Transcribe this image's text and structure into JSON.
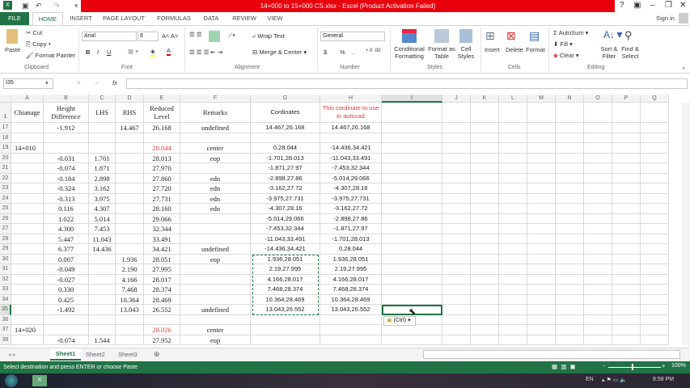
{
  "window": {
    "title": "14+000 to 15+000 CS.xlsx -  Excel (Product Activation Failed)",
    "help": "?",
    "sign_in": "Sign in"
  },
  "tabs": [
    "FILE",
    "HOME",
    "INSERT",
    "PAGE LAYOUT",
    "FORMULAS",
    "DATA",
    "REVIEW",
    "VIEW"
  ],
  "ribbon": {
    "clipboard": {
      "paste": "Paste",
      "cut": "Cut",
      "copy": "Copy",
      "format_painter": "Format Painter",
      "label": "Clipboard"
    },
    "font": {
      "name": "Arial",
      "size": "8",
      "label": "Font",
      "bold": "B",
      "italic": "I",
      "underline": "U"
    },
    "alignment": {
      "wrap": "Wrap Text",
      "merge": "Merge & Center",
      "label": "Alignment"
    },
    "number": {
      "format": "General",
      "currency": "$",
      "percent": "%",
      "comma": ",",
      "label": "Number"
    },
    "styles": {
      "cond": "Conditional",
      "cond2": "Formatting",
      "fat": "Format as",
      "fat2": "Table",
      "cs": "Cell",
      "cs2": "Styles",
      "label": "Styles"
    },
    "cells": {
      "insert": "Insert",
      "delete": "Delete",
      "format": "Format",
      "label": "Cells"
    },
    "editing": {
      "autosum": "AutoSum",
      "fill": "Fill",
      "clear": "Clear",
      "sort": "Sort &",
      "sort2": "Filter",
      "find": "Find &",
      "find2": "Select",
      "label": "Editing"
    }
  },
  "formula_bar": {
    "name_box": "I35",
    "fx": "fx",
    "value": ""
  },
  "columns": [
    "A",
    "B",
    "C",
    "D",
    "E",
    "F",
    "G",
    "H",
    "I",
    "J",
    "K",
    "L",
    "M",
    "N",
    "O",
    "P",
    "Q"
  ],
  "header_row": {
    "num": "1",
    "cells": [
      "Chianage",
      "Height Difference",
      "LHS",
      "RHS",
      "Reduced Level",
      "Remarks",
      "Cordinates",
      "This cordinate to use in autocad"
    ]
  },
  "rows": [
    {
      "n": "17",
      "c": [
        "",
        "-1.912",
        "",
        "14.467",
        "26.168",
        "undefined",
        "14.467,26.168",
        "14.467,26.168"
      ]
    },
    {
      "n": "18",
      "c": [
        "",
        "",
        "",
        "",
        "",
        "",
        "",
        ""
      ]
    },
    {
      "n": "19",
      "c": [
        "14+010",
        "",
        "",
        "",
        "28.044",
        "center",
        "0,28.044",
        "-14.436,34.421"
      ]
    },
    {
      "n": "20",
      "c": [
        "",
        "-0.031",
        "1.701",
        "",
        "28.013",
        "eop",
        "-1.701,28.013",
        "-11.043,33.491"
      ]
    },
    {
      "n": "21",
      "c": [
        "",
        "-0.074",
        "1.871",
        "",
        "27.970",
        "",
        "-1.871,27.97",
        "-7.453,32.344"
      ]
    },
    {
      "n": "22",
      "c": [
        "",
        "-0.184",
        "2.898",
        "",
        "27.860",
        "edn",
        "-2.898,27.86",
        "-5.014,29.066"
      ]
    },
    {
      "n": "23",
      "c": [
        "",
        "-0.324",
        "3.162",
        "",
        "27.720",
        "edn",
        "-3.162,27.72",
        "-4.307,28.16"
      ]
    },
    {
      "n": "24",
      "c": [
        "",
        "-0.313",
        "3.975",
        "",
        "27.731",
        "edn",
        "-3.975,27.731",
        "-3.975,27.731"
      ]
    },
    {
      "n": "25",
      "c": [
        "",
        "0.116",
        "4.307",
        "",
        "28.160",
        "edn",
        "-4.307,28.16",
        "-3.162,27.72"
      ]
    },
    {
      "n": "26",
      "c": [
        "",
        "1.022",
        "5.014",
        "",
        "29.066",
        "",
        "-5.014,29.066",
        "-2.898,27.86"
      ]
    },
    {
      "n": "27",
      "c": [
        "",
        "4.300",
        "7.453",
        "",
        "32.344",
        "",
        "-7.453,32.344",
        "-1.871,27.97"
      ]
    },
    {
      "n": "28",
      "c": [
        "",
        "5.447",
        "11.043",
        "",
        "33.491",
        "",
        "-11.043,33.491",
        "-1.701,28.013"
      ]
    },
    {
      "n": "29",
      "c": [
        "",
        "6.377",
        "14.436",
        "",
        "34.421",
        "undefined",
        "-14.436,34.421",
        "0,28.044"
      ]
    },
    {
      "n": "30",
      "c": [
        "",
        "0.007",
        "",
        "1.936",
        "28.051",
        "eop",
        "1.936,28.051",
        "1.936,28.051"
      ]
    },
    {
      "n": "31",
      "c": [
        "",
        "-0.049",
        "",
        "2.190",
        "27.995",
        "",
        "2.19,27.995",
        "2.19,27.995"
      ]
    },
    {
      "n": "32",
      "c": [
        "",
        "-0.027",
        "",
        "4.166",
        "28.017",
        "",
        "4.166,28.017",
        "4.166,28.017"
      ]
    },
    {
      "n": "33",
      "c": [
        "",
        "0.330",
        "",
        "7.468",
        "28.374",
        "",
        "7.468,28.374",
        "7.468,28.374"
      ]
    },
    {
      "n": "34",
      "c": [
        "",
        "0.425",
        "",
        "10.364",
        "28.469",
        "",
        "10.364,28.469",
        "10.364,28.469"
      ]
    },
    {
      "n": "35",
      "c": [
        "",
        "-1.492",
        "",
        "13.043",
        "26.552",
        "undefined",
        "13.043,26.552",
        "13.043,26.552"
      ]
    },
    {
      "n": "36",
      "c": [
        "",
        "",
        "",
        "",
        "",
        "",
        "",
        ""
      ]
    },
    {
      "n": "37",
      "c": [
        "14+020",
        "",
        "",
        "",
        "28.026",
        "center",
        "",
        ""
      ]
    },
    {
      "n": "38",
      "c": [
        "",
        "-0.074",
        "1.544",
        "",
        "27.952",
        "eop",
        "",
        ""
      ]
    }
  ],
  "paste_options": "(Ctrl)",
  "sheets": [
    "Sheet1",
    "Sheet2",
    "Sheet3"
  ],
  "status": {
    "text": "Select destination and press ENTER or choose Paste",
    "zoom": "100%"
  },
  "taskbar": {
    "lang": "EN",
    "time": "8:58 PM"
  },
  "colors": {
    "excel_green": "#217346",
    "title_red": "#e8000b",
    "red_text": "#e03a3a"
  }
}
